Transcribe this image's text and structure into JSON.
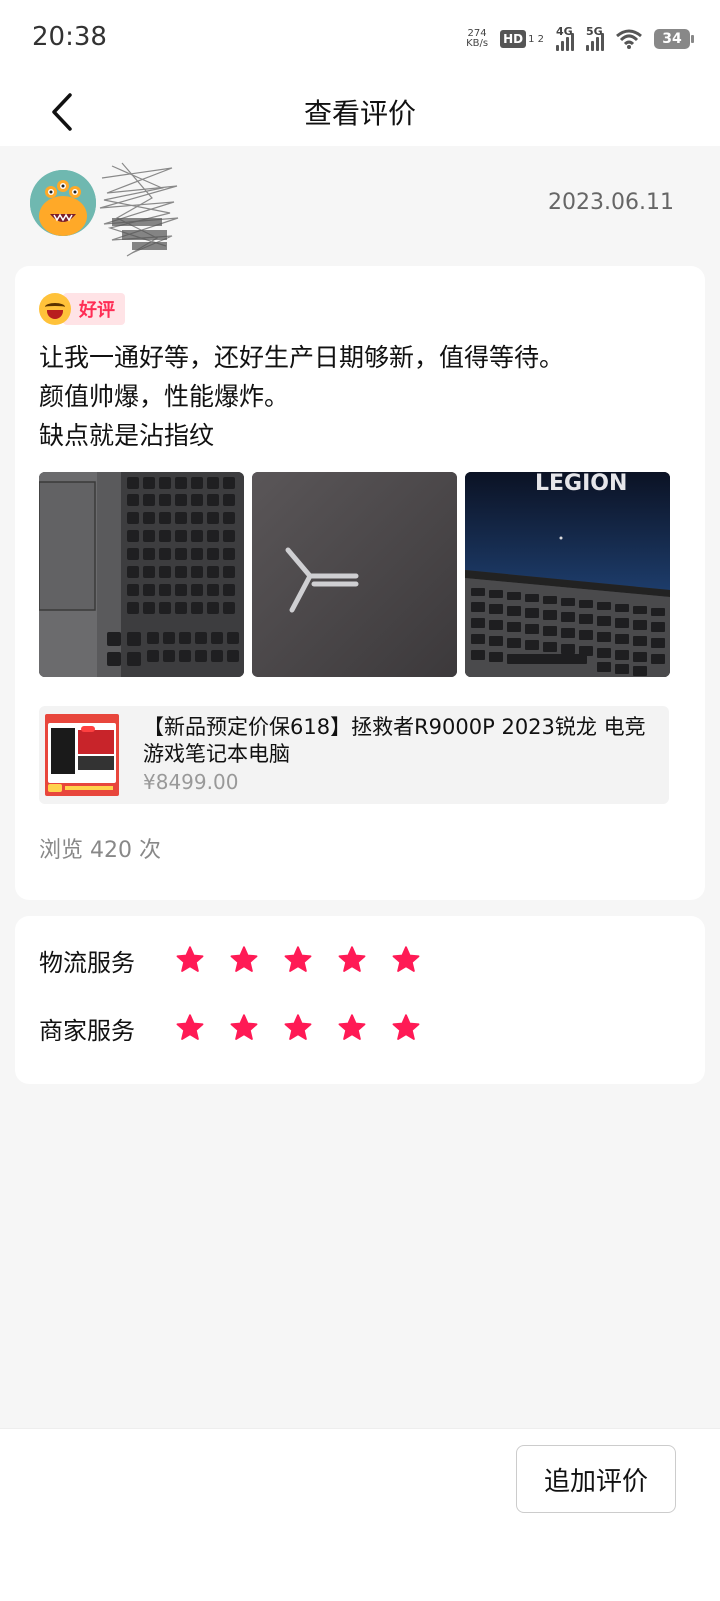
{
  "status_bar": {
    "time": "20:38",
    "net_speed_value": "274",
    "net_speed_unit": "KB/s",
    "hd_label": "HD",
    "hd_sub": "1 2",
    "signal_1_label": "4G",
    "signal_2_label": "5G",
    "battery": "34"
  },
  "nav": {
    "title": "查看评价",
    "back_icon": "chevron-left-icon"
  },
  "reviewer": {
    "date": "2023.06.11"
  },
  "review": {
    "badge_label": "好评",
    "text_lines": [
      "让我一通好等，还好生产日期够新，值得等待。",
      "颜值帅爆，性能爆炸。",
      "缺点就是沾指纹"
    ],
    "photos": [
      "keyboard-photo",
      "lid-logo-photo",
      "legion-screen-photo"
    ],
    "photo_3_screen_text": "LEGION"
  },
  "product": {
    "title": "【新品预定价保618】拯救者R9000P 2023锐龙 电竞游戏笔记本电脑",
    "price": "¥8499.00"
  },
  "views": "浏览 420 次",
  "ratings": [
    {
      "label": "物流服务",
      "stars": 5,
      "max": 5
    },
    {
      "label": "商家服务",
      "stars": 5,
      "max": 5
    }
  ],
  "colors": {
    "star": "#ff1a55",
    "badge_text": "#ff2d55",
    "badge_bg": "#ffe3e6"
  },
  "bottom": {
    "add_review_label": "追加评价"
  }
}
